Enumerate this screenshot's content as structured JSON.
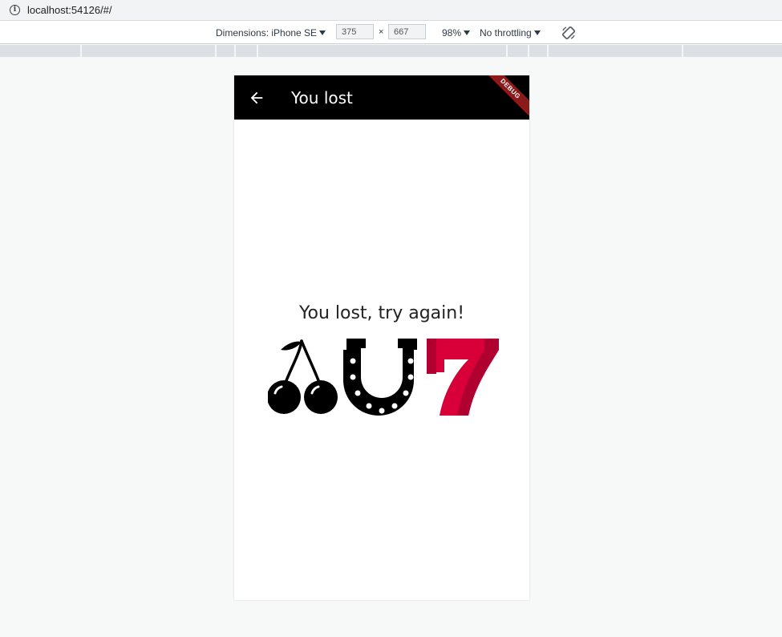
{
  "browser": {
    "url": "localhost:54126/#/"
  },
  "devtools": {
    "dimensions_label": "Dimensions: iPhone SE",
    "width_value": "375",
    "height_value": "667",
    "times_sign": "×",
    "zoom_label": "98%",
    "throttling_label": "No throttling",
    "rotate_icon": "rotate-icon"
  },
  "app": {
    "appbar_title": "You lost",
    "back_icon": "arrow-back-icon",
    "debug_banner": "DEBUG",
    "message": "You lost, try again!",
    "symbols": [
      "cherries-icon",
      "horseshoe-icon",
      "seven-icon"
    ],
    "colors": {
      "appbar": "#000000",
      "seven": "#d9003a",
      "debug_banner": "#8b1a1a"
    }
  }
}
